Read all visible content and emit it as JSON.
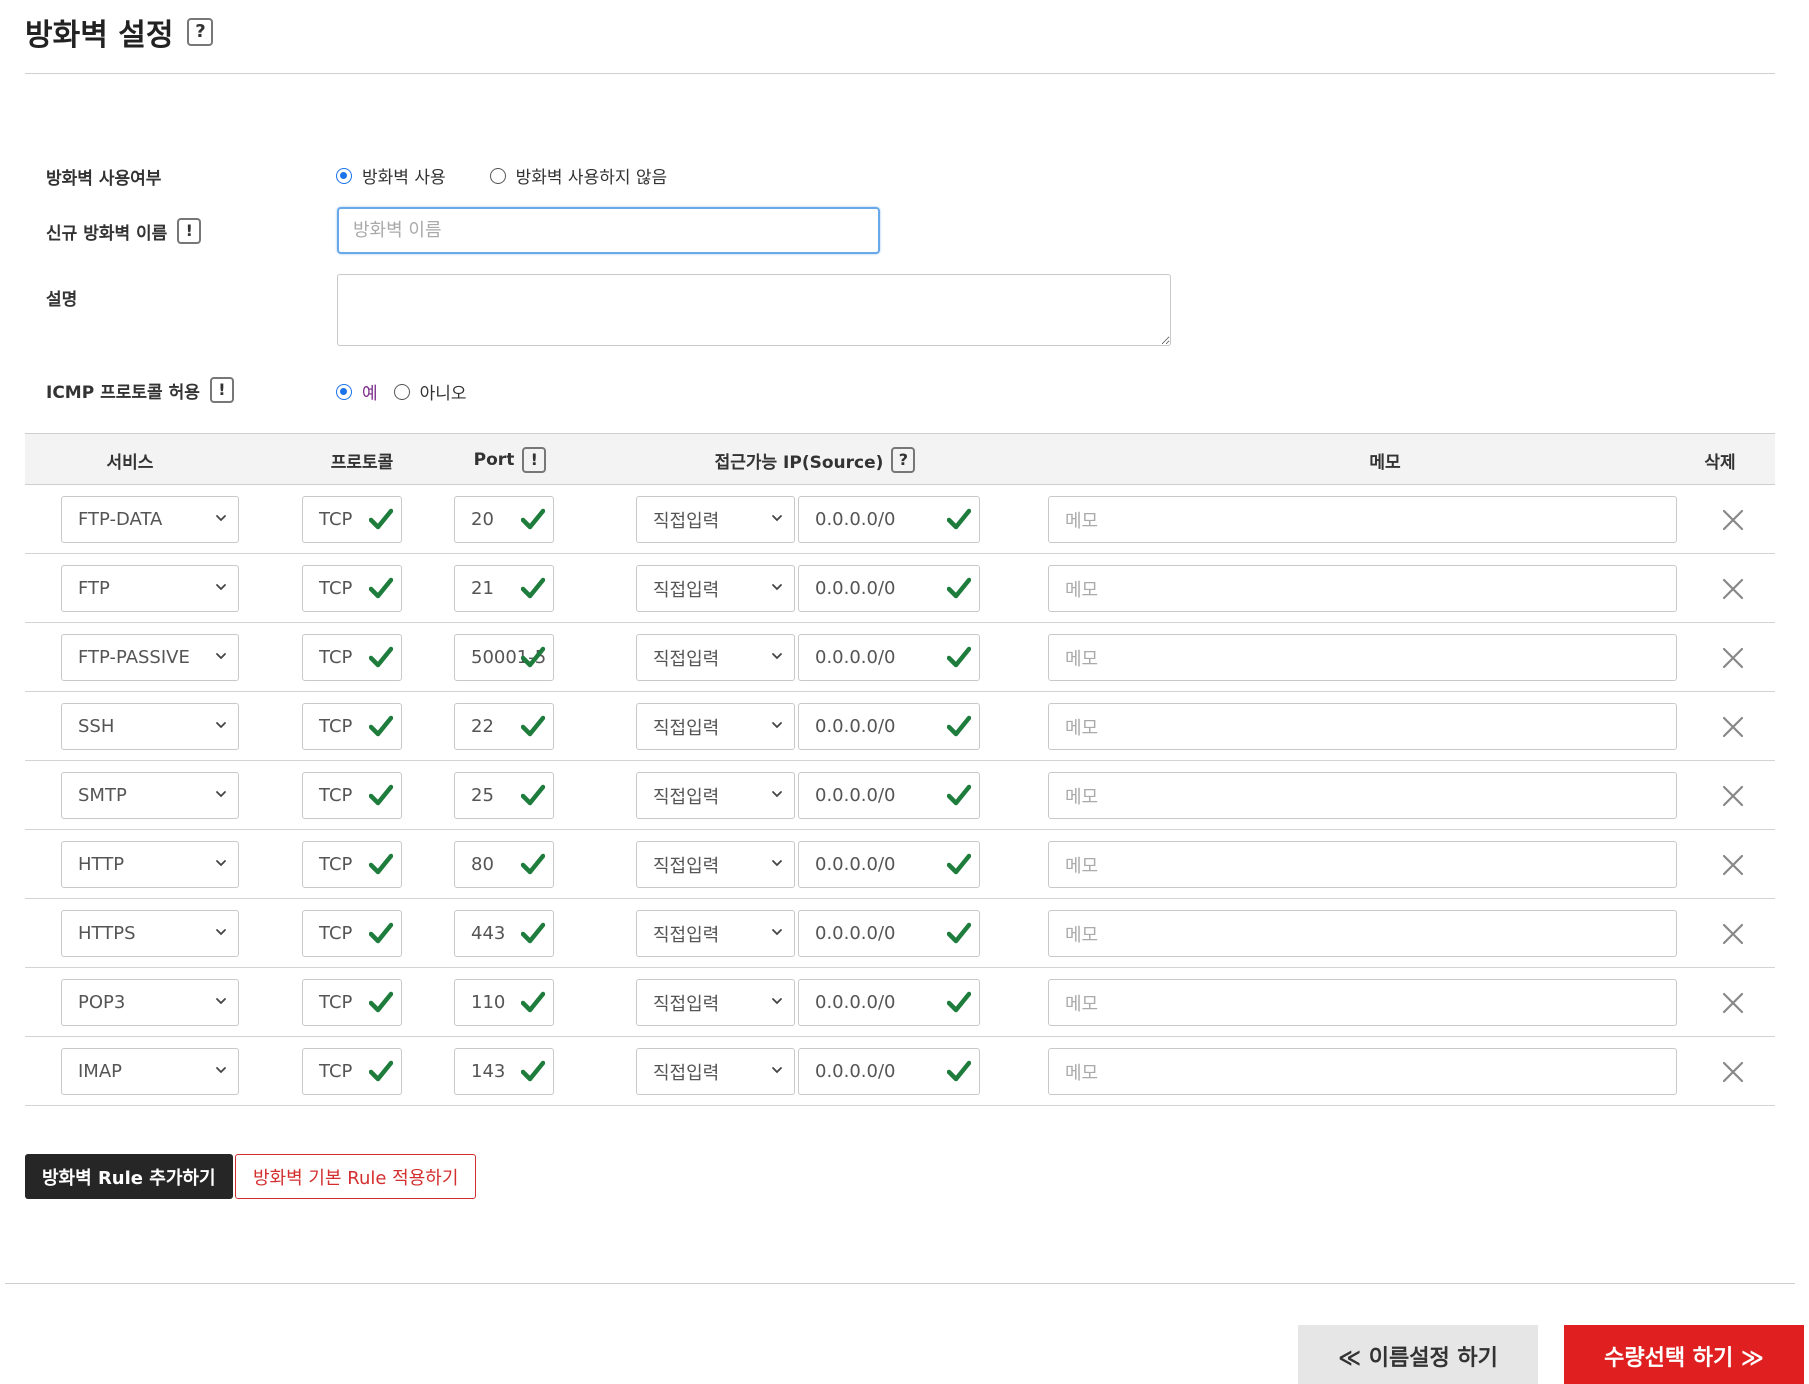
{
  "page": {
    "title": "방화벽 설정",
    "help_glyph": "?",
    "warn_glyph": "!"
  },
  "form": {
    "usage_label": "방화벽 사용여부",
    "usage_options": [
      "방화벽 사용",
      "방화벽 사용하지 않음"
    ],
    "usage_selected": "방화벽 사용",
    "name_label": "신규 방화벽 이름",
    "name_placeholder": "방화벽 이름",
    "name_value": "",
    "desc_label": "설명",
    "desc_value": "",
    "icmp_label": "ICMP 프로토콜 허용",
    "icmp_options": [
      "예",
      "아니오"
    ],
    "icmp_selected": "예"
  },
  "table": {
    "headers": {
      "service": "서비스",
      "protocol": "프로토콜",
      "port": "Port",
      "source": "접근가능 IP(Source)",
      "memo": "메모",
      "delete": "삭제"
    },
    "rows": [
      {
        "service": "FTP-DATA",
        "protocol": "TCP",
        "port": "20",
        "source_type": "직접입력",
        "source_ip": "0.0.0.0/0",
        "memo_placeholder": "메모"
      },
      {
        "service": "FTP",
        "protocol": "TCP",
        "port": "21",
        "source_type": "직접입력",
        "source_ip": "0.0.0.0/0",
        "memo_placeholder": "메모"
      },
      {
        "service": "FTP-PASSIVE",
        "protocol": "TCP",
        "port": "50001-5",
        "source_type": "직접입력",
        "source_ip": "0.0.0.0/0",
        "memo_placeholder": "메모"
      },
      {
        "service": "SSH",
        "protocol": "TCP",
        "port": "22",
        "source_type": "직접입력",
        "source_ip": "0.0.0.0/0",
        "memo_placeholder": "메모"
      },
      {
        "service": "SMTP",
        "protocol": "TCP",
        "port": "25",
        "source_type": "직접입력",
        "source_ip": "0.0.0.0/0",
        "memo_placeholder": "메모"
      },
      {
        "service": "HTTP",
        "protocol": "TCP",
        "port": "80",
        "source_type": "직접입력",
        "source_ip": "0.0.0.0/0",
        "memo_placeholder": "메모"
      },
      {
        "service": "HTTPS",
        "protocol": "TCP",
        "port": "443",
        "source_type": "직접입력",
        "source_ip": "0.0.0.0/0",
        "memo_placeholder": "메모"
      },
      {
        "service": "POP3",
        "protocol": "TCP",
        "port": "110",
        "source_type": "직접입력",
        "source_ip": "0.0.0.0/0",
        "memo_placeholder": "메모"
      },
      {
        "service": "IMAP",
        "protocol": "TCP",
        "port": "143",
        "source_type": "직접입력",
        "source_ip": "0.0.0.0/0",
        "memo_placeholder": "메모"
      }
    ]
  },
  "actions": {
    "add_rule": "방화벽 Rule 추가하기",
    "apply_default": "방화벽 기본 Rule 적용하기",
    "prev": "≪ 이름설정 하기",
    "next": "수량선택 하기 ≫"
  },
  "colors": {
    "accent_blue": "#1a73e8",
    "check_green": "#1e7d3c",
    "primary_red": "#e02020",
    "dark_button": "#262626"
  },
  "icons": {
    "check": "check-icon",
    "chevron": "chevron-down-icon",
    "delete": "close-icon",
    "help": "help-icon",
    "warning": "info-icon"
  }
}
